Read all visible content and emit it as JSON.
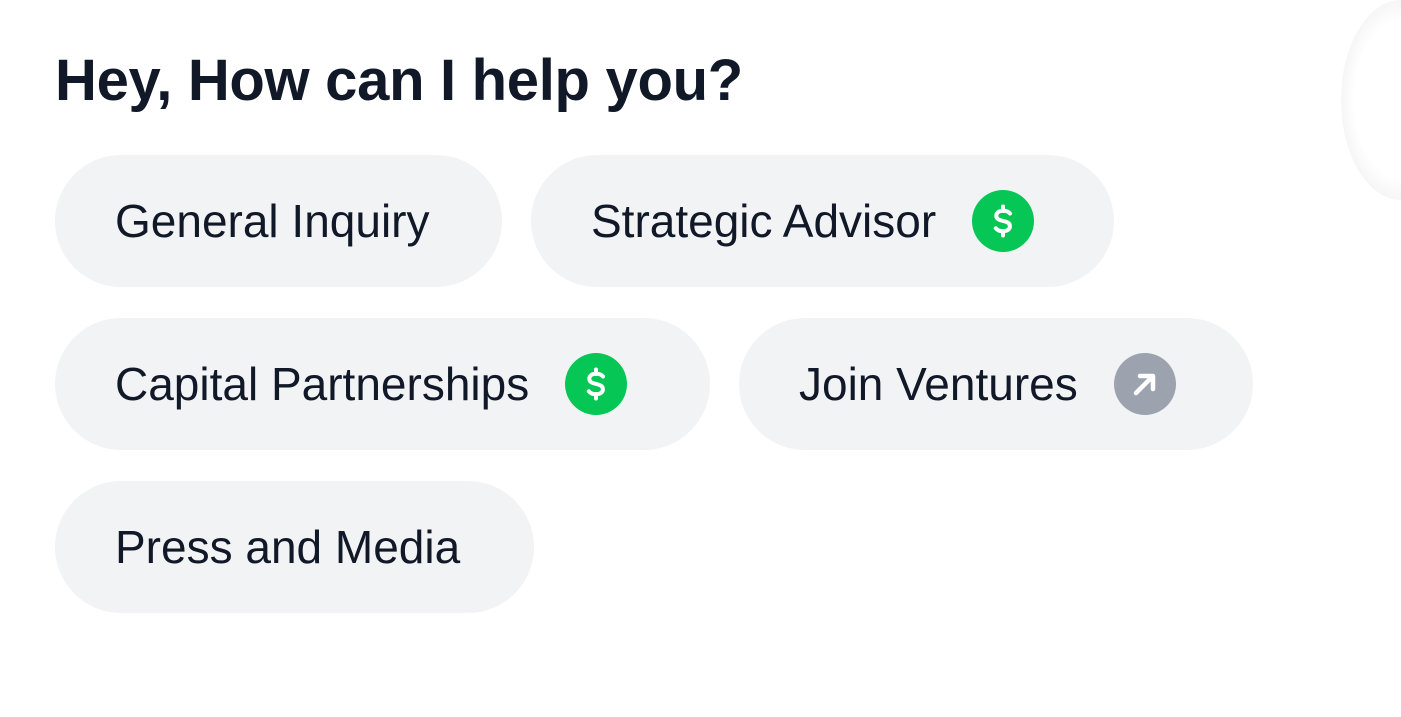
{
  "heading": "Hey, How can I help you?",
  "colors": {
    "chip_bg": "#f2f3f5",
    "text": "#111827",
    "paid_badge": "#06c755",
    "external_badge": "#9ca3af"
  },
  "options": [
    {
      "label": "General Inquiry",
      "icon": null
    },
    {
      "label": "Strategic Advisor",
      "icon": "dollar-icon"
    },
    {
      "label": "Capital Partnerships",
      "icon": "dollar-icon"
    },
    {
      "label": "Join Ventures",
      "icon": "external-arrow-icon"
    },
    {
      "label": "Press and Media",
      "icon": null
    }
  ]
}
